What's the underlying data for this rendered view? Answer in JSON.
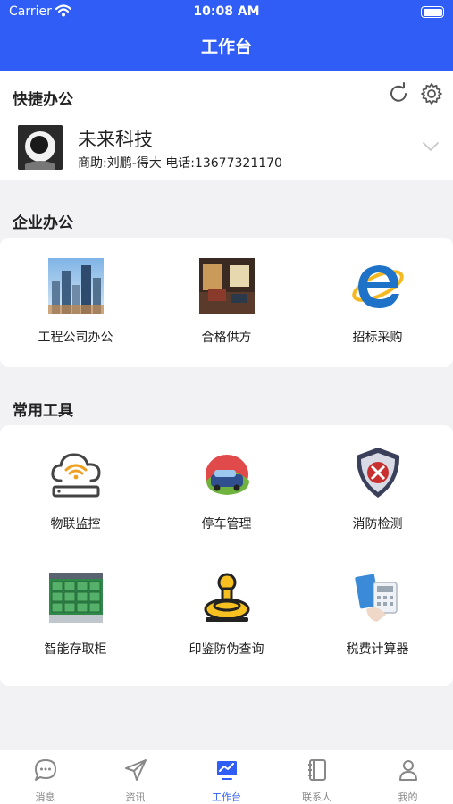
{
  "status_bar": {
    "carrier": "Carrier",
    "time": "10:08 AM"
  },
  "nav": {
    "title": "工作台"
  },
  "quick_office": {
    "title": "快捷办公",
    "company_name": "未来科技",
    "company_sub": "商助:刘鹏-得大  电话:13677321170"
  },
  "enterprise": {
    "title": "企业办公",
    "items": [
      {
        "label": "工程公司办公",
        "icon": "building-icon"
      },
      {
        "label": "合格供方",
        "icon": "supplier-room-icon"
      },
      {
        "label": "招标采购",
        "icon": "internet-explorer-icon"
      }
    ]
  },
  "tools": {
    "title": "常用工具",
    "items": [
      {
        "label": "物联监控",
        "icon": "iot-cloud-icon"
      },
      {
        "label": "停车管理",
        "icon": "parking-car-icon"
      },
      {
        "label": "消防检测",
        "icon": "fire-badge-icon"
      },
      {
        "label": "智能存取柜",
        "icon": "locker-icon"
      },
      {
        "label": "印鉴防伪查询",
        "icon": "stamp-icon"
      },
      {
        "label": "税费计算器",
        "icon": "tax-calculator-icon"
      }
    ]
  },
  "tabs": [
    {
      "label": "消息",
      "icon": "chat-bubble-icon",
      "active": false
    },
    {
      "label": "资讯",
      "icon": "paper-plane-icon",
      "active": false
    },
    {
      "label": "工作台",
      "icon": "monitor-chart-icon",
      "active": true
    },
    {
      "label": "联系人",
      "icon": "contact-book-icon",
      "active": false
    },
    {
      "label": "我的",
      "icon": "person-icon",
      "active": false
    }
  ],
  "colors": {
    "accent": "#2f5df5",
    "background": "#f2f2f5",
    "inactive_tab": "#888888"
  }
}
